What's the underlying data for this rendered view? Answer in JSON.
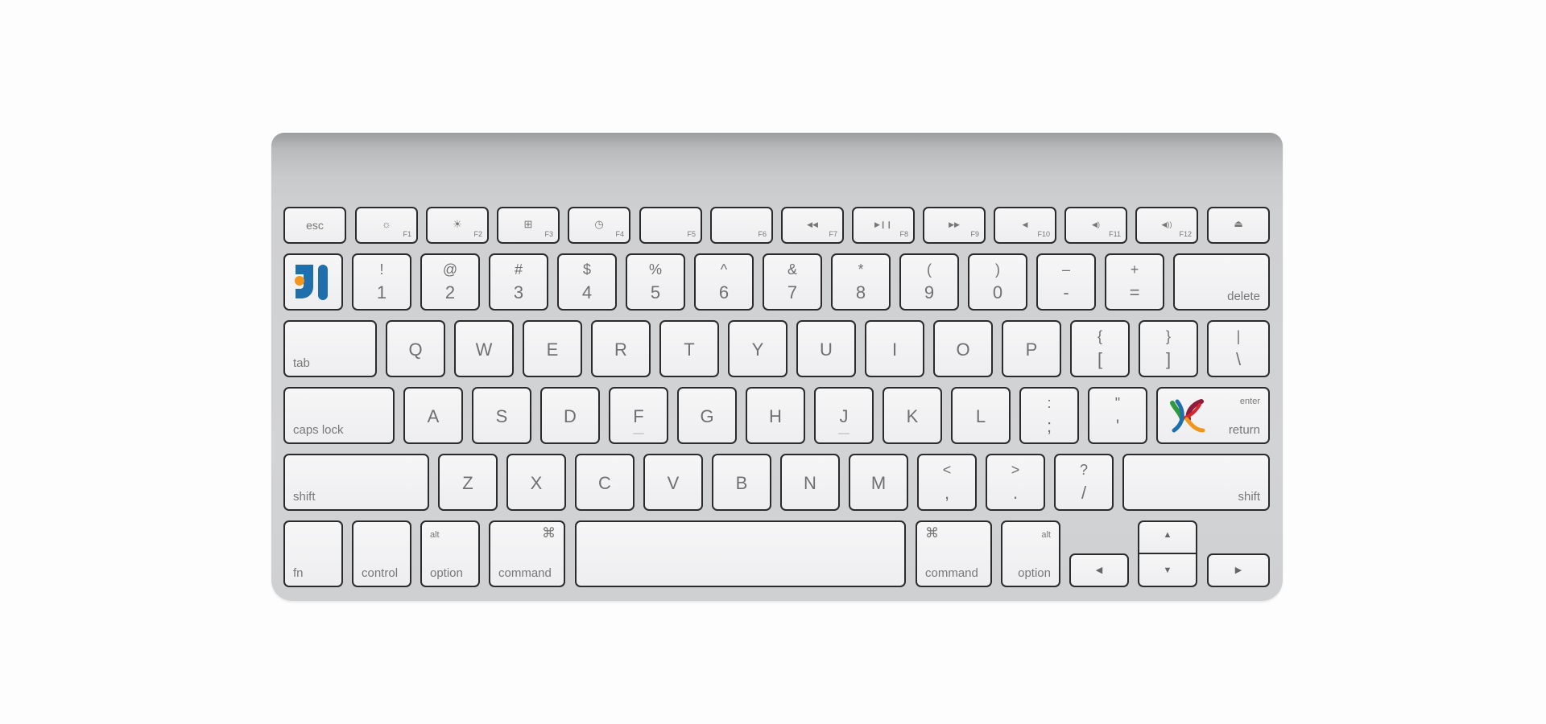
{
  "keyboard": {
    "fn_row": [
      {
        "label": "esc",
        "fkey": "",
        "icon": ""
      },
      {
        "label": "",
        "fkey": "F1",
        "icon": "☼"
      },
      {
        "label": "",
        "fkey": "F2",
        "icon": "☀"
      },
      {
        "label": "",
        "fkey": "F3",
        "icon": "⊞"
      },
      {
        "label": "",
        "fkey": "F4",
        "icon": "◷"
      },
      {
        "label": "",
        "fkey": "F5",
        "icon": ""
      },
      {
        "label": "",
        "fkey": "F6",
        "icon": ""
      },
      {
        "label": "",
        "fkey": "F7",
        "icon": "◀◀"
      },
      {
        "label": "",
        "fkey": "F8",
        "icon": "▶❙❙"
      },
      {
        "label": "",
        "fkey": "F9",
        "icon": "▶▶"
      },
      {
        "label": "",
        "fkey": "F10",
        "icon": "◀"
      },
      {
        "label": "",
        "fkey": "F11",
        "icon": "◀)"
      },
      {
        "label": "",
        "fkey": "F12",
        "icon": "◀))"
      },
      {
        "label": "",
        "fkey": "",
        "icon": "⏏"
      }
    ],
    "number_row": [
      {
        "top": "!",
        "bottom": "1"
      },
      {
        "top": "@",
        "bottom": "2"
      },
      {
        "top": "#",
        "bottom": "3"
      },
      {
        "top": "$",
        "bottom": "4"
      },
      {
        "top": "%",
        "bottom": "5"
      },
      {
        "top": "^",
        "bottom": "6"
      },
      {
        "top": "&",
        "bottom": "7"
      },
      {
        "top": "*",
        "bottom": "8"
      },
      {
        "top": "(",
        "bottom": "9"
      },
      {
        "top": ")",
        "bottom": "0"
      },
      {
        "top": "–",
        "bottom": "-"
      },
      {
        "top": "+",
        "bottom": "="
      }
    ],
    "delete_label": "delete",
    "tab_label": "tab",
    "qwerty_row": [
      "Q",
      "W",
      "E",
      "R",
      "T",
      "Y",
      "U",
      "I",
      "O",
      "P"
    ],
    "bracket_keys": [
      {
        "top": "{",
        "bottom": "["
      },
      {
        "top": "}",
        "bottom": "]"
      },
      {
        "top": "|",
        "bottom": "\\"
      }
    ],
    "caps_label": "caps lock",
    "home_row": [
      "A",
      "S",
      "D",
      "F",
      "G",
      "H",
      "J",
      "K",
      "L"
    ],
    "home_symbol_keys": [
      {
        "top": ":",
        "bottom": ";"
      },
      {
        "top": "\"",
        "bottom": "'"
      }
    ],
    "enter_label": "enter",
    "return_label": "return",
    "shift_label": "shift",
    "bottom_letter_row": [
      "Z",
      "X",
      "C",
      "V",
      "B",
      "N",
      "M"
    ],
    "bottom_symbol_keys": [
      {
        "top": "<",
        "bottom": ","
      },
      {
        "top": ">",
        "bottom": "."
      },
      {
        "top": "?",
        "bottom": "/"
      }
    ],
    "fn_label": "fn",
    "control_label": "control",
    "alt_label": "alt",
    "option_label": "option",
    "command_label": "command",
    "command_symbol": "⌘",
    "arrows": {
      "up": "▲",
      "down": "▼",
      "left": "◀",
      "right": "▶"
    }
  },
  "logos": {
    "top_left_key": "jetbrains-logo",
    "return_key": "colorful-logo"
  },
  "colors": {
    "logo_blue": "#1e6fab",
    "logo_orange": "#f1961d"
  }
}
